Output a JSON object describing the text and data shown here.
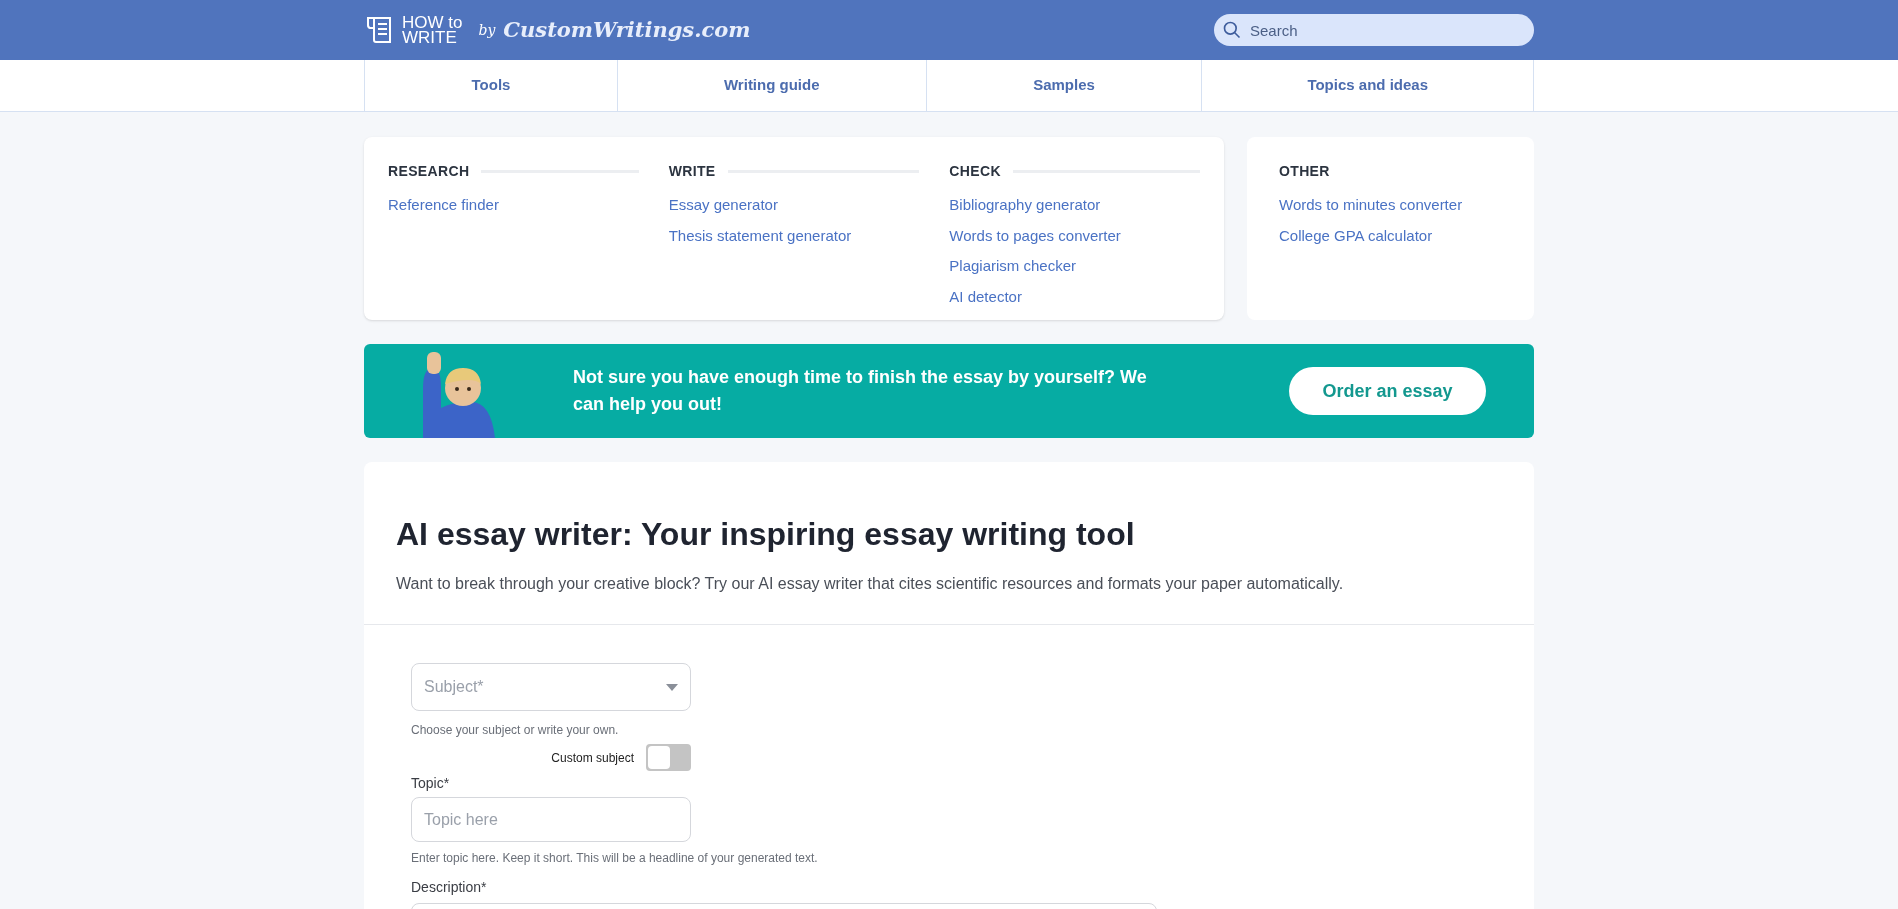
{
  "header": {
    "logo": {
      "line_1": "HOW to",
      "line_2": "WRITE",
      "by": "by",
      "brand": "CustomWritings.com"
    },
    "search": {
      "placeholder": "Search"
    }
  },
  "nav": [
    {
      "label": "Tools"
    },
    {
      "label": "Writing guide"
    },
    {
      "label": "Samples"
    },
    {
      "label": "Topics and ideas"
    }
  ],
  "tools_menu": {
    "groups": [
      {
        "title": "RESEARCH",
        "links": [
          "Reference finder"
        ]
      },
      {
        "title": "WRITE",
        "links": [
          "Essay generator",
          "Thesis statement generator"
        ]
      },
      {
        "title": "CHECK",
        "links": [
          "Bibliography generator",
          "Words to pages converter",
          "Plagiarism checker",
          "AI detector"
        ]
      }
    ],
    "other": {
      "title": "OTHER",
      "links": [
        "Words to minutes converter",
        "College GPA calculator"
      ]
    }
  },
  "banner": {
    "text": "Not sure you have enough time to finish the essay by yourself? We can help you out!",
    "button": "Order an essay"
  },
  "main": {
    "title": "AI essay writer: Your inspiring essay writing tool",
    "intro": "Want to break through your creative block? Try our AI essay writer that cites scientific resources and formats your paper automatically.",
    "form": {
      "subject": {
        "placeholder": "Subject*",
        "hint": "Choose your subject or write your own."
      },
      "custom_subject": {
        "label": "Custom subject",
        "on": false
      },
      "topic": {
        "label": "Topic*",
        "placeholder": "Topic here",
        "hint": "Enter topic here. Keep it short. This will be a headline of your generated text."
      },
      "description": {
        "label": "Description*"
      }
    }
  }
}
